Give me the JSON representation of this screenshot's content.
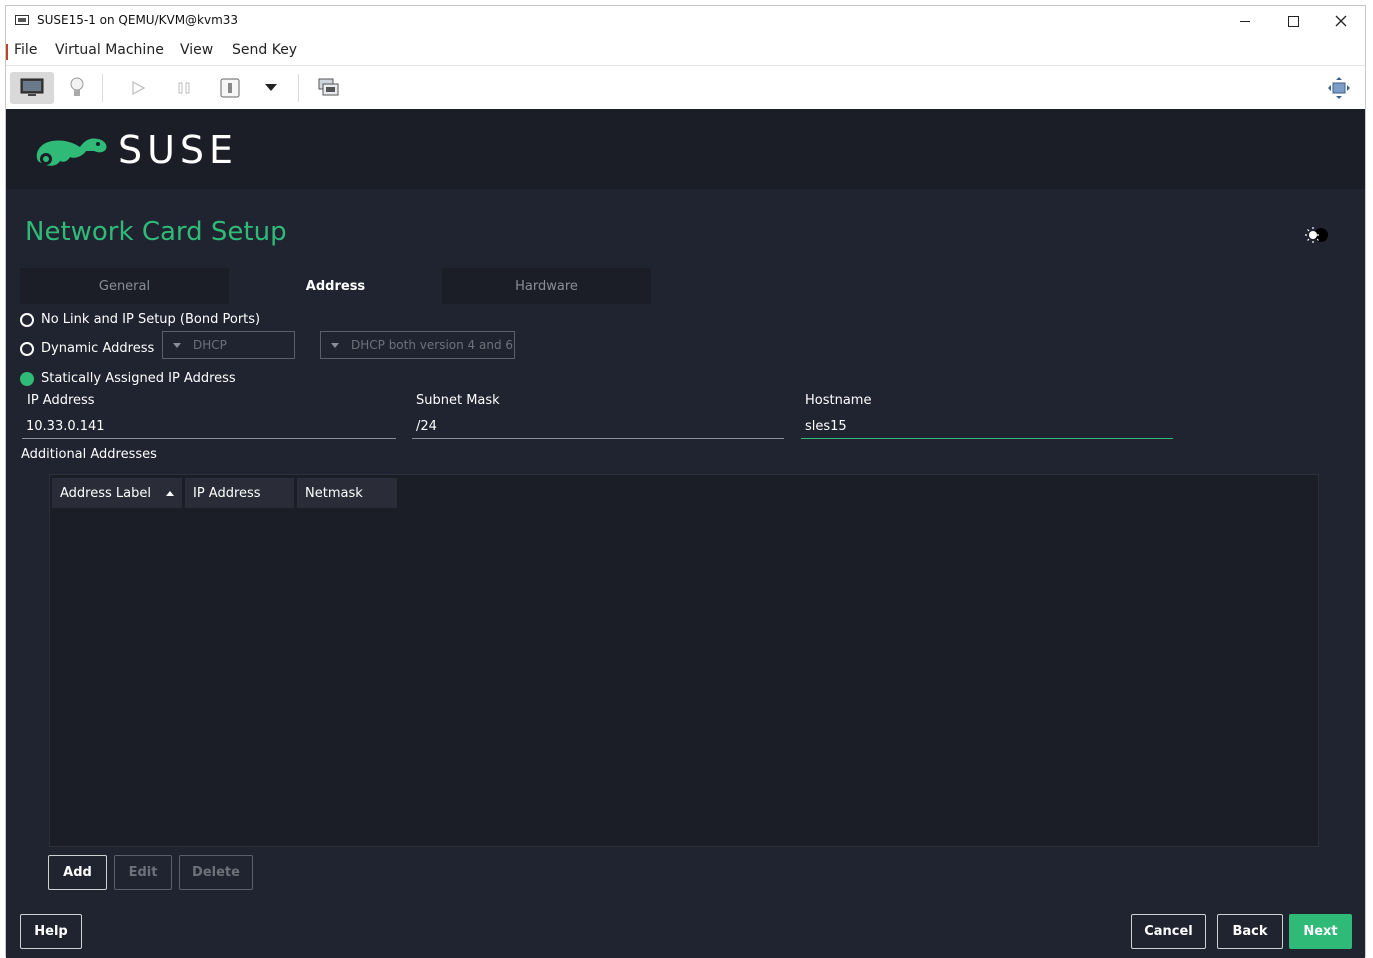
{
  "window": {
    "title": "SUSE15-1 on QEMU/KVM@kvm33"
  },
  "menubar": {
    "items": [
      {
        "label": "File",
        "mnemonic": "F"
      },
      {
        "label": "Virtual Machine",
        "mnemonic": "M"
      },
      {
        "label": "View",
        "mnemonic": "V"
      },
      {
        "label": "Send Key",
        "mnemonic": "K"
      }
    ]
  },
  "toolbar": {
    "icons": [
      "monitor-icon",
      "lightbulb-icon",
      "play-icon",
      "pause-icon",
      "power-icon",
      "dropdown-arrow-icon",
      "snapshot-icon",
      "fullscreen-icon"
    ]
  },
  "brand": {
    "logo_text": "SUSE",
    "accent": "#30ba78",
    "bg_dark": "#1b1e27",
    "bg": "#202330"
  },
  "page": {
    "title": "Network Card Setup"
  },
  "tabs": [
    {
      "label": "General",
      "active": false
    },
    {
      "label": "Address",
      "active": true
    },
    {
      "label": "Hardware",
      "active": false
    }
  ],
  "address_mode": {
    "options": [
      {
        "label": "No Link and IP Setup (Bond Ports)",
        "selected": false
      },
      {
        "label": "Dynamic Address",
        "selected": false
      },
      {
        "label": "Statically Assigned IP Address",
        "selected": true
      }
    ],
    "dhcp_select": "DHCP",
    "dhcp_version_select": "DHCP both version 4 and 6"
  },
  "fields": {
    "ip": {
      "label": "IP Address",
      "value": "10.33.0.141"
    },
    "subnet": {
      "label": "Subnet Mask",
      "value": "/24"
    },
    "hostname": {
      "label": "Hostname",
      "value": "sles15"
    }
  },
  "additional": {
    "label": "Additional Addresses",
    "columns": [
      "Address Label",
      "IP Address",
      "Netmask"
    ],
    "rows": []
  },
  "table_buttons": {
    "add": "Add",
    "edit": "Edit",
    "delete": "Delete"
  },
  "footer": {
    "help": "Help",
    "cancel": "Cancel",
    "back": "Back",
    "next": "Next"
  }
}
